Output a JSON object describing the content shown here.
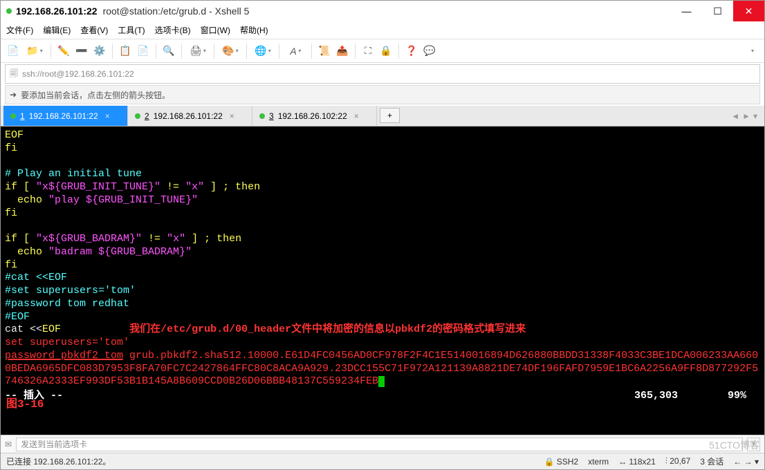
{
  "window": {
    "ip_title": "192.168.26.101:22",
    "subtitle": "root@station:/etc/grub.d - Xshell 5"
  },
  "menu": {
    "file": "文件(F)",
    "edit": "编辑(E)",
    "view": "查看(V)",
    "tools": "工具(T)",
    "tabs": "选项卡(B)",
    "window": "窗口(W)",
    "help": "帮助(H)"
  },
  "address": {
    "icon": "🗐",
    "url": "ssh://root@192.168.26.101:22"
  },
  "hint": {
    "arrow": "➜",
    "text": "要添加当前会话，点击左侧的箭头按钮。"
  },
  "tabs": [
    {
      "index": "1",
      "label": "192.168.26.101:22",
      "active": true
    },
    {
      "index": "2",
      "label": "192.168.26.101:22",
      "active": false
    },
    {
      "index": "3",
      "label": "192.168.26.102:22",
      "active": false
    }
  ],
  "terminal": {
    "l1": "EOF",
    "l2": "fi",
    "l3": "# Play an initial tune",
    "l4a": "if [ ",
    "l4b": "\"x${GRUB_INIT_TUNE}\"",
    "l4c": " != ",
    "l4d": "\"x\"",
    "l4e": " ] ; then",
    "l5a": "  echo ",
    "l5b": "\"play ${GRUB_INIT_TUNE}\"",
    "l6": "fi",
    "l7a": "if [ ",
    "l7b": "\"x${GRUB_BADRAM}\"",
    "l7c": " != ",
    "l7d": "\"x\"",
    "l7e": " ] ; then",
    "l8a": "  echo ",
    "l8b": "\"badram ${GRUB_BADRAM}\"",
    "l9": "fi",
    "l10": "#cat <<EOF",
    "l11": "#set superusers='tom'",
    "l12": "#password tom redhat",
    "l13": "#EOF",
    "l14a": "cat <<",
    "l14b": "EOF",
    "annot": "我们在/etc/grub.d/00_header文件中将加密的信息以pbkdf2的密码格式填写进来",
    "l15": "set superusers='tom'",
    "l16u": "password_pbkdf2 tom",
    "l16r": " grub.pbkdf2.sha512.10000.E61D4FC0456AD0CF978F2F4C1E5140016894D626880BBDD31338F4033C3BE1DCA006233AA6600BEDA6965DFC083D7953F8FA70FC7C2427864FFC80C8ACA9A929.23DCC155C71F972A121139A8821DE74DF196FAFD7959E1BC6A2256A9FF8D877292F5746326A2333EF993DF53B1B145A8B609CCD0B26D06BBB48137C559234FEB",
    "mode": "-- 插入 --",
    "pos": "365,303",
    "pct": "99%",
    "fig": "图3-16"
  },
  "inputbar": {
    "placeholder": "发送到当前选项卡"
  },
  "status": {
    "conn": "已连接 192.168.26.101:22。",
    "ssh": "SSH2",
    "term": "xterm",
    "size": "118x21",
    "rc": "20,67",
    "sess": "3 会话"
  },
  "watermark": "51CTO博客"
}
